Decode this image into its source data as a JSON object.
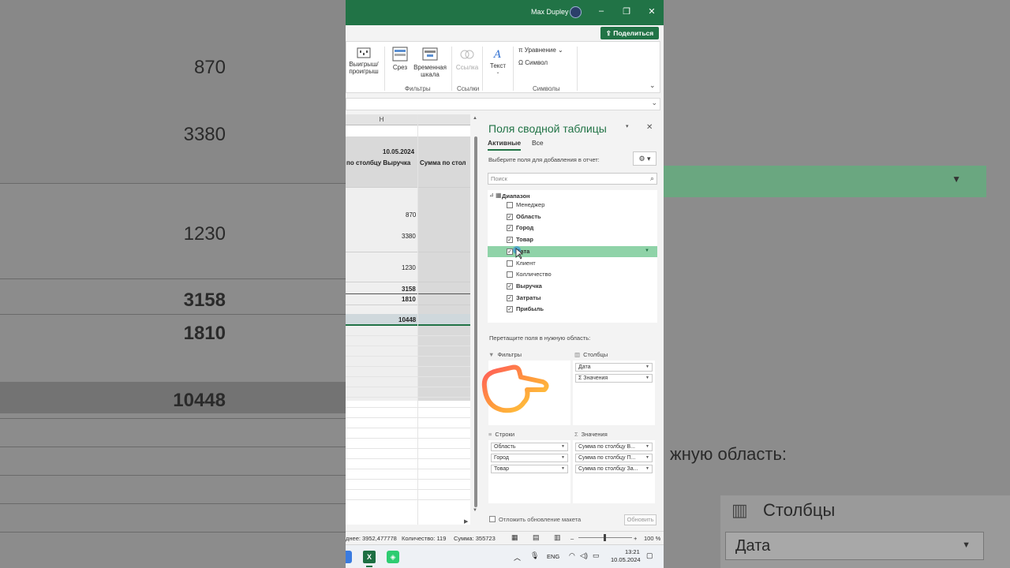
{
  "titlebar": {
    "user_name": "Max Dupley",
    "minimize": "–",
    "restore": "❐",
    "close": "✕"
  },
  "share": {
    "label": "Поделиться"
  },
  "ribbon": {
    "items": {
      "winloss": "Выигрыш/ проигрыш",
      "slicer": "Срез",
      "timeline": "Временная шкала",
      "link": "Ссылка",
      "text": "Текст",
      "equation": "Уравнение",
      "symbol": "Символ"
    },
    "groups": {
      "filters": "Фильтры",
      "links": "Ссылки",
      "symbols": "Символы"
    }
  },
  "grid": {
    "column_header": "H",
    "date_header": "10.05.2024",
    "col_h_label": "по столбцу Выручка",
    "col_i_label": "Сумма по стол",
    "values": [
      "870",
      "3380",
      "1230",
      "3158",
      "1810",
      "10448"
    ]
  },
  "pane": {
    "title": "Поля сводной таблицы",
    "tabs": [
      "Активные",
      "Все"
    ],
    "hint": "Выберите поля для добавления в отчет:",
    "search_placeholder": "Поиск",
    "root": "Диапазон",
    "fields": [
      {
        "label": "Менеджер",
        "checked": false,
        "bold": false
      },
      {
        "label": "Область",
        "checked": true,
        "bold": true
      },
      {
        "label": "Город",
        "checked": true,
        "bold": true
      },
      {
        "label": "Товар",
        "checked": true,
        "bold": true
      },
      {
        "label": "Дата",
        "checked": true,
        "bold": true,
        "highlighted": true
      },
      {
        "label": "Клиент",
        "checked": false,
        "bold": false
      },
      {
        "label": "Колличество",
        "checked": false,
        "bold": false
      },
      {
        "label": "Выручка",
        "checked": true,
        "bold": true
      },
      {
        "label": "Затраты",
        "checked": true,
        "bold": true
      },
      {
        "label": "Прибыль",
        "checked": true,
        "bold": true
      }
    ],
    "drag_hint": "Перетащите поля в нужную область:",
    "areas": {
      "filters": {
        "title": "Фильтры",
        "items": []
      },
      "columns": {
        "title": "Столбцы",
        "items": [
          "Дата",
          "Σ  Значения"
        ]
      },
      "rows": {
        "title": "Строки",
        "items": [
          "Область",
          "Город",
          "Товар"
        ]
      },
      "values": {
        "title": "Значения",
        "items": [
          "Сумма по столбцу В...",
          "Сумма по столбцу П...",
          "Сумма по столбцу За..."
        ]
      }
    },
    "defer_label": "Отложить обновление макета",
    "update_button": "Обновить"
  },
  "statusbar": {
    "average": "днее: 3952,477778",
    "count": "Количество: 119",
    "sum": "Сумма: 355723",
    "zoom": "100 %"
  },
  "taskbar": {
    "language": "ENG",
    "time": "13:21",
    "date": "10.05.2024"
  },
  "background": {
    "left_values": [
      "870",
      "3380",
      "1230",
      "3158",
      "1810",
      "10448"
    ],
    "right_text_1": "жную область:",
    "right_text_2": "Столбцы",
    "right_text_3": "Дата"
  },
  "colors": {
    "accent": "#217346",
    "highlight": "#8fd3a8"
  }
}
